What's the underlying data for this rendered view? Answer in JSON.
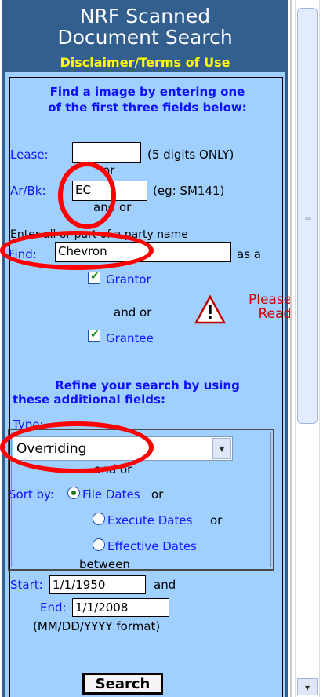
{
  "header": {
    "title_line1": "NRF Scanned",
    "title_line2": "Document Search",
    "disclaimer_link": "Disclaimer/Terms of Use"
  },
  "search_intro": {
    "line1": "Find a image by entering one",
    "line2": "of the first three fields below:"
  },
  "lease": {
    "label": "Lease:",
    "value": "",
    "hint": "(5 digits ONLY)"
  },
  "connector_or": "or",
  "arbk": {
    "label": "Ar/Bk:",
    "value": "EC",
    "hint": "(eg: SM141)"
  },
  "connector_and_or": "and or",
  "party_hint": "Enter all or part of a party name",
  "find": {
    "label": "Find:",
    "value": "Chevron",
    "suffix": "as a"
  },
  "grantor": {
    "label": "Grantor",
    "checked": true
  },
  "connector_and_or_2": "and or",
  "grantee": {
    "label": "Grantee",
    "checked": true
  },
  "please_read": {
    "line1": "Please",
    "line2": "Read"
  },
  "refine": {
    "line1": "Refine your search by using",
    "line2": "these additional fields:"
  },
  "type": {
    "label": "Type:",
    "selected": "Overriding"
  },
  "connector_and_or_3": "and or",
  "sort_by": {
    "label": "Sort by:",
    "options": [
      {
        "label": "File Dates",
        "suffix": "or",
        "selected": true
      },
      {
        "label": "Execute Dates",
        "suffix": "or",
        "selected": false
      },
      {
        "label": "Effective Dates",
        "suffix": "",
        "selected": false
      }
    ]
  },
  "between": "between",
  "start": {
    "label": "Start:",
    "value": "1/1/1950",
    "suffix": "and"
  },
  "end": {
    "label": "End:",
    "value": "1/1/2008"
  },
  "date_format": "(MM/DD/YYYY format)",
  "search_button": "Search",
  "colors": {
    "header_bg": "#335f8f",
    "form_bg": "#9fd0ff",
    "label_blue": "#1515ff",
    "callout_red": "#ff0000",
    "link_yellow": "#ffff00"
  }
}
